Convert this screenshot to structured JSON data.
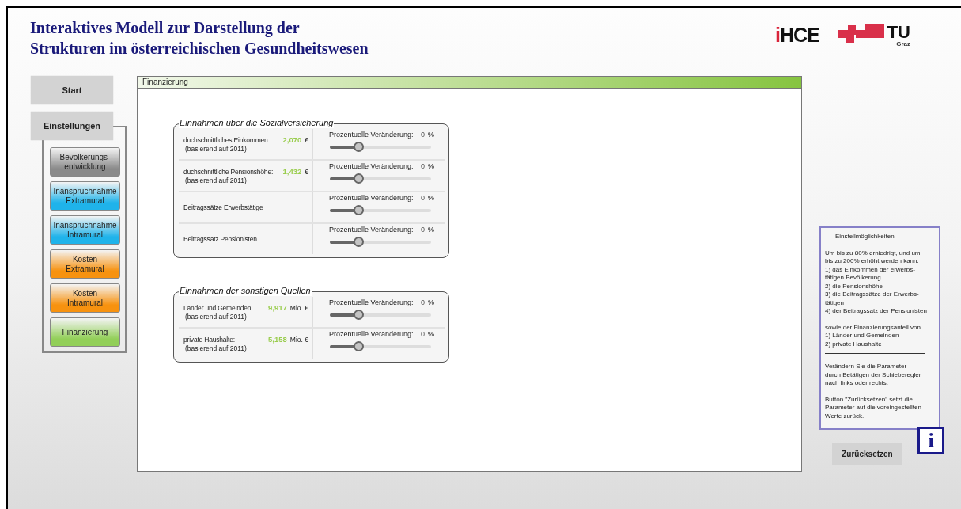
{
  "title_lines": [
    "Interaktives Modell zur Darstellung der",
    "Strukturen im österreichischen Gesundheitswesen"
  ],
  "logos": {
    "ihce_accent": "i",
    "ihce_text": "HCE",
    "tu_text": "TU",
    "tu_sub": "Graz"
  },
  "nav": {
    "start": "Start",
    "settings": "Einstellungen",
    "items": [
      {
        "label": "Bevölkerungs-\nentwicklung",
        "color": "#8a8a8a"
      },
      {
        "label": "Inanspruchnahme\nExtramural",
        "color": "#1fb3ea"
      },
      {
        "label": "Inanspruchnahme\nIntramural",
        "color": "#1fb3ea"
      },
      {
        "label": "Kosten\nExtramural",
        "color": "#f7920f"
      },
      {
        "label": "Kosten\nIntramural",
        "color": "#f7920f"
      },
      {
        "label": "Finanzierung",
        "color": "#92cf58"
      }
    ]
  },
  "panel": {
    "title": "Finanzierung",
    "groups": [
      {
        "title": "Einnahmen über die Sozialversicherung",
        "rows": [
          {
            "label": "duchschnittliches Einkommen:",
            "sub": "(basierend auf 2011)",
            "value": "2,070",
            "unit": "€",
            "change_label": "Prozentuelle Veränderung:",
            "change": "0",
            "percent": "%",
            "level": 0.29
          },
          {
            "label": "duchschnittliche Pensionshöhe:",
            "sub": "(basierend auf 2011)",
            "value": "1,432",
            "unit": "€",
            "change_label": "Prozentuelle Veränderung:",
            "change": "0",
            "percent": "%",
            "level": 0.29
          },
          {
            "label": "Beitragssätze Erwerbstätige",
            "change_label": "Prozentuelle Veränderung:",
            "change": "0",
            "percent": "%",
            "level": 0.29
          },
          {
            "label": "Beitragssatz Pensionisten",
            "change_label": "Prozentuelle Veränderung:",
            "change": "0",
            "percent": "%",
            "level": 0.29
          }
        ]
      },
      {
        "title": "Einnahmen der sonstigen Quellen",
        "rows": [
          {
            "label": "Länder und Gemeinden:",
            "sub": "(basierend auf 2011)",
            "value": "9,917",
            "unit": "Mio. €",
            "change_label": "Prozentuelle Veränderung:",
            "change": "0",
            "percent": "%",
            "level": 0.29
          },
          {
            "label": "private Haushalte:",
            "sub": "(basierend auf 2011)",
            "value": "5,158",
            "unit": "Mio. €",
            "change_label": "Prozentuelle Veränderung:",
            "change": "0",
            "percent": "%",
            "level": 0.29
          }
        ]
      }
    ]
  },
  "info": {
    "paragraphs_top": [
      "---- Einstellmöglichkeiten ----",
      "Um bis zu 80% erniedrigt, und um\nbis zu 200% erhöht werden kann:\n1) das Einkommen der erwerbs-\ntätigen Bevölkerung\n2) die Pensionshöhe\n3) die Beitragssätze der Erwerbs-\ntätigen\n4) der Beitragssatz der Pensionisten",
      "sowie der Finanzierungsanteil von\n1) Länder und Gemeinden\n2) private Haushalte"
    ],
    "paragraphs_bottom": [
      "Verändern Sie die Parameter\ndurch Betätigen der Schieberegler\nnach links oder rechts.",
      "Button \"Zurücksetzen\" setzt die\nParameter auf die voreingestellten\nWerte zurück."
    ],
    "icon": "i"
  },
  "reset_button": "Zurücksetzen"
}
